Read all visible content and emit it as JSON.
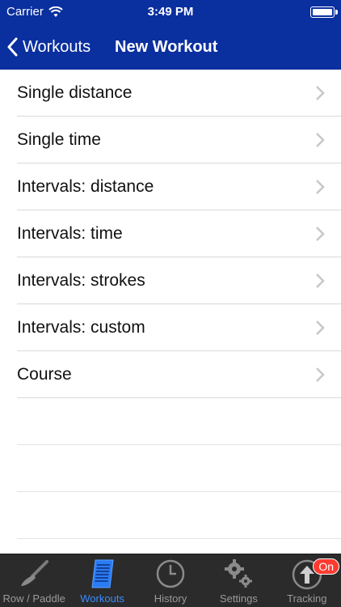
{
  "status_bar": {
    "carrier": "Carrier",
    "time": "3:49 PM"
  },
  "nav": {
    "back_label": "Workouts",
    "title": "New Workout"
  },
  "list": {
    "items": [
      {
        "label": "Single distance"
      },
      {
        "label": "Single time"
      },
      {
        "label": "Intervals: distance"
      },
      {
        "label": "Intervals: time"
      },
      {
        "label": "Intervals: strokes"
      },
      {
        "label": "Intervals: custom"
      },
      {
        "label": "Course"
      }
    ]
  },
  "tabbar": {
    "tabs": [
      {
        "label": "Row / Paddle",
        "icon": "paddle-icon"
      },
      {
        "label": "Workouts",
        "icon": "workouts-list-icon",
        "active": true
      },
      {
        "label": "History",
        "icon": "clock-icon"
      },
      {
        "label": "Settings",
        "icon": "gears-icon"
      },
      {
        "label": "Tracking",
        "icon": "upload-arrow-icon",
        "badge": "On"
      }
    ]
  },
  "colors": {
    "nav_bg": "#0a2f9f",
    "tab_active": "#3a8cff",
    "tabbar_bg": "#2b2b2b",
    "badge": "#ff3b30"
  }
}
